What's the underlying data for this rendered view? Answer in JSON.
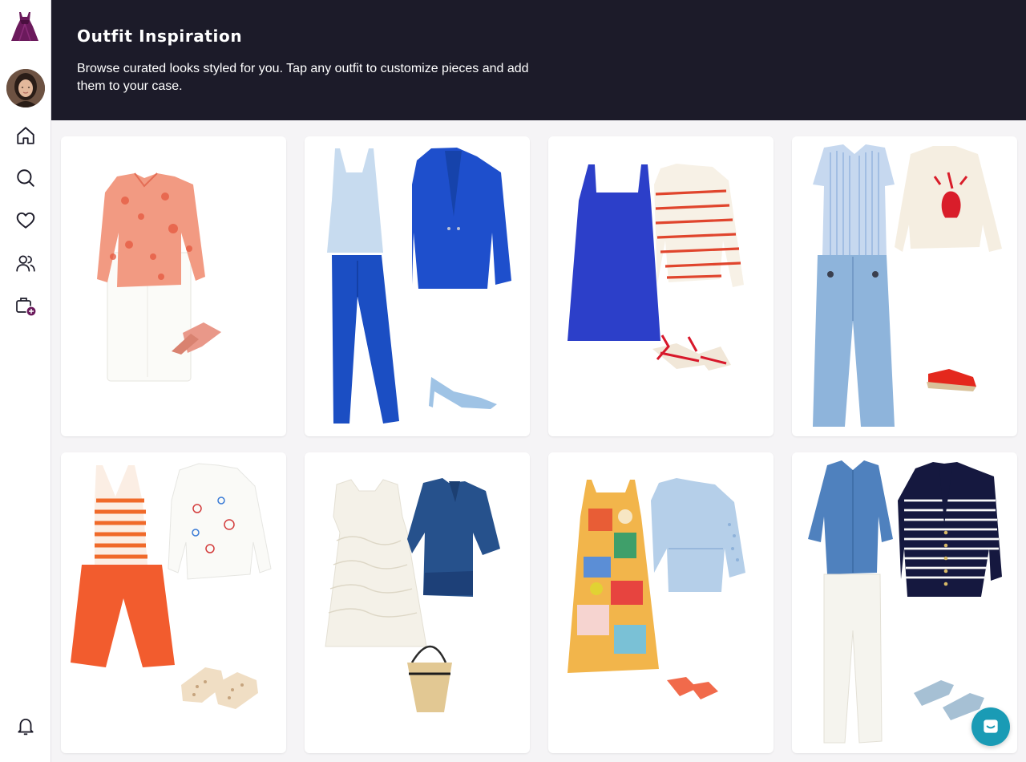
{
  "header": {
    "title": "Outfit Inspiration",
    "subtitle": "Browse curated looks styled for you. Tap any outfit to customize pieces and add them to your case."
  },
  "sidebar": {
    "logo_icon": "dress-logo-icon",
    "items": [
      {
        "icon": "home-icon"
      },
      {
        "icon": "search-icon"
      },
      {
        "icon": "heart-icon"
      },
      {
        "icon": "users-icon"
      },
      {
        "icon": "case-add-icon"
      },
      {
        "icon": "bell-icon"
      }
    ]
  },
  "colors": {
    "header_bg": "#1c1b29",
    "brand": "#6b1a5c",
    "chat": "#1a9bb5"
  },
  "outfits": [
    {
      "pieces": [
        "coral print shirt",
        "white shorts",
        "pink mules"
      ]
    },
    {
      "pieces": [
        "light blue tank",
        "cobalt trousers",
        "cobalt blazer",
        "blue slingbacks"
      ]
    },
    {
      "pieces": [
        "cobalt mini dress",
        "striped sweater",
        "red espadrilles"
      ]
    },
    {
      "pieces": [
        "striped blue shirt",
        "wide-leg jeans",
        "lobster sweater",
        "red espadrilles"
      ]
    },
    {
      "pieces": [
        "striped tank",
        "orange shorts",
        "embroidered shirt",
        "woven flats"
      ]
    },
    {
      "pieces": [
        "white eyelet dress",
        "denim shirt",
        "straw tote"
      ]
    },
    {
      "pieces": [
        "printed sundress",
        "denim jacket",
        "coral sandals"
      ]
    },
    {
      "pieces": [
        "chambray shirt",
        "white jeans",
        "striped cardigan",
        "blue ballet flats"
      ]
    }
  ],
  "chat": {
    "icon": "chat-icon"
  }
}
